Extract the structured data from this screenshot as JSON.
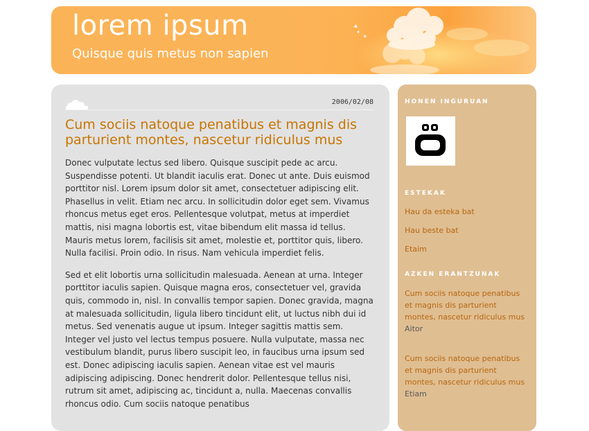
{
  "header": {
    "title": "lorem ipsum",
    "subtitle": "Quisque quis metus non sapien"
  },
  "post": {
    "date": "2006/02/08",
    "title": "Cum sociis natoque penatibus et magnis dis parturient montes, nascetur ridiculus mus",
    "paragraphs": [
      "Donec vulputate lectus sed libero. Quisque suscipit pede ac arcu. Suspendisse potenti. Ut blandit iaculis erat. Donec ut ante. Duis euismod porttitor nisl. Lorem ipsum dolor sit amet, consectetuer adipiscing elit. Phasellus in velit. Etiam nec arcu. In sollicitudin dolor eget sem. Vivamus rhoncus metus eget eros. Pellentesque volutpat, metus at imperdiet mattis, nisi magna lobortis est, vitae bibendum elit massa id tellus. Mauris metus lorem, facilisis sit amet, molestie et, porttitor quis, libero. Nulla facilisi. Proin odio. In risus. Nam vehicula imperdiet felis.",
      "Sed et elit lobortis urna sollicitudin malesuada. Aenean at urna. Integer porttitor iaculis sapien. Quisque magna eros, consectetuer vel, gravida quis, commodo in, nisl. In convallis tempor sapien. Donec gravida, magna at malesuada sollicitudin, ligula libero tincidunt elit, ut luctus nibh dui id metus. Sed venenatis augue ut ipsum. Integer sagittis mattis sem. Integer vel justo vel lectus tempus posuere. Nulla vulputate, massa nec vestibulum blandit, purus libero suscipit leo, in faucibus urna ipsum sed est. Donec adipiscing iaculis sapien. Aenean vitae est vel mauris adipiscing adipiscing. Donec hendrerit dolor. Pellentesque tellus nisi, rutrum sit amet, adipiscing ac, tincidunt a, nulla. Maecenas convallis rhoncus odio. Cum sociis natoque penatibus"
    ]
  },
  "sidebar": {
    "about_heading": "HONEN INGURUAN",
    "logo_icon": "blogger-face-icon",
    "links_heading": "ESTEKAK",
    "links": [
      "Hau da esteka bat",
      "Hau beste bat",
      "Etaim"
    ],
    "replies_heading": "AZKEN ERANTZUNAK",
    "replies": [
      {
        "title": "Cum sociis natoque penatibus et magnis dis parturient montes, nascetur ridiculus mus",
        "author": "Aitor"
      },
      {
        "title": "Cum sociis natoque penatibus et magnis dis parturient montes, nascetur ridiculus mus",
        "author": "Etiam"
      }
    ]
  },
  "colors": {
    "header_orange": "#fbb357",
    "post_title": "#c87400",
    "sidebar_bg": "#dfbe92",
    "sidebar_link": "#b9660e",
    "main_bg": "#e2e2e2"
  }
}
